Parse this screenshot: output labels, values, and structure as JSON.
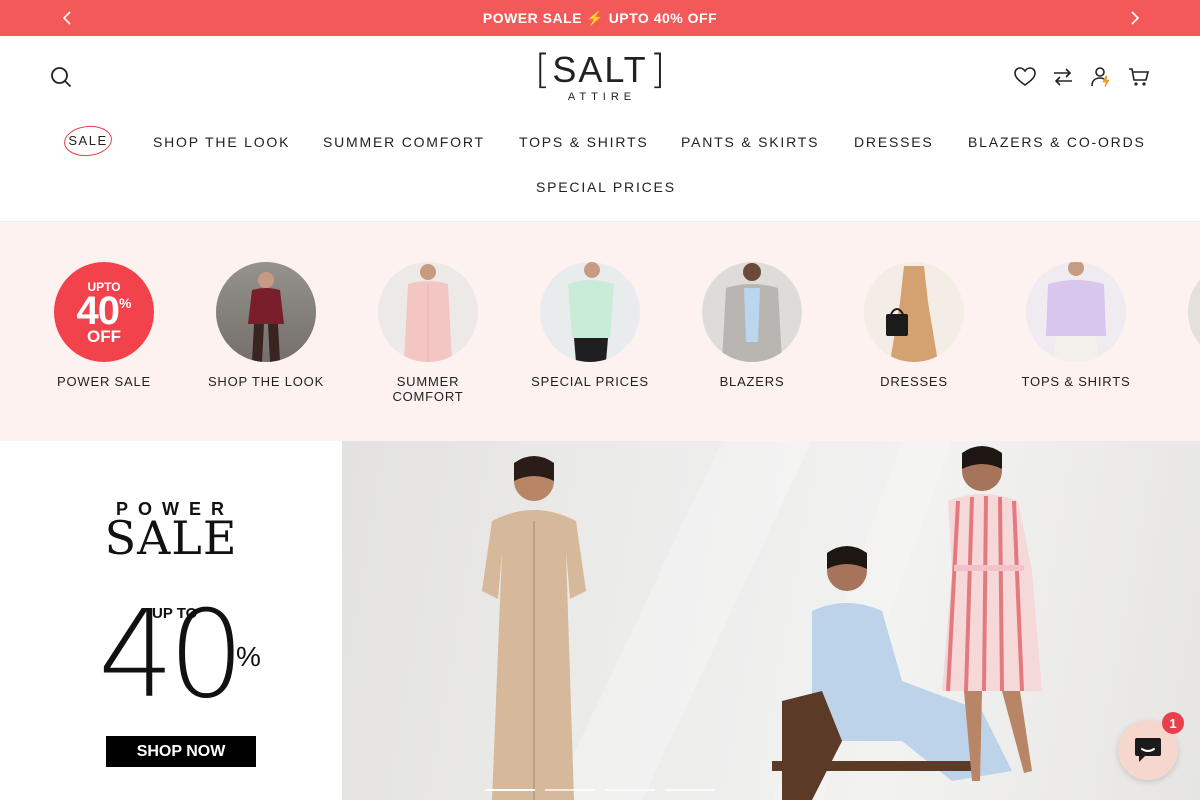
{
  "announcement": {
    "text": "POWER SALE ⚡ UPTO 40% OFF",
    "bg_color": "#f4595a"
  },
  "header": {
    "logo": {
      "main": "SALT",
      "sub": "ATTIRE"
    },
    "icons": [
      "search-icon",
      "heart-icon",
      "compare-icon",
      "account-icon",
      "cart-icon"
    ]
  },
  "nav": {
    "items": [
      {
        "label": "SALE"
      },
      {
        "label": "SHOP THE LOOK"
      },
      {
        "label": "SUMMER COMFORT"
      },
      {
        "label": "TOPS & SHIRTS"
      },
      {
        "label": "PANTS & SKIRTS"
      },
      {
        "label": "DRESSES"
      },
      {
        "label": "BLAZERS & CO-ORDS"
      },
      {
        "label": "SPECIAL PRICES"
      }
    ]
  },
  "categories": [
    {
      "label": "POWER SALE",
      "badge": {
        "upto": "UPTO",
        "amount": "40",
        "pct": "%",
        "off": "OFF"
      }
    },
    {
      "label": "SHOP THE LOOK"
    },
    {
      "label": "SUMMER COMFORT"
    },
    {
      "label": "SPECIAL PRICES"
    },
    {
      "label": "BLAZERS"
    },
    {
      "label": "DRESSES"
    },
    {
      "label": "TOPS & SHIRTS"
    }
  ],
  "hero": {
    "kicker": "POWER",
    "title": "SALE",
    "upto": "UP TO",
    "amount": "40",
    "pct": "%",
    "cta": "SHOP NOW"
  },
  "slider": {
    "total": 4,
    "active": 1
  },
  "chat": {
    "badge": "1"
  }
}
